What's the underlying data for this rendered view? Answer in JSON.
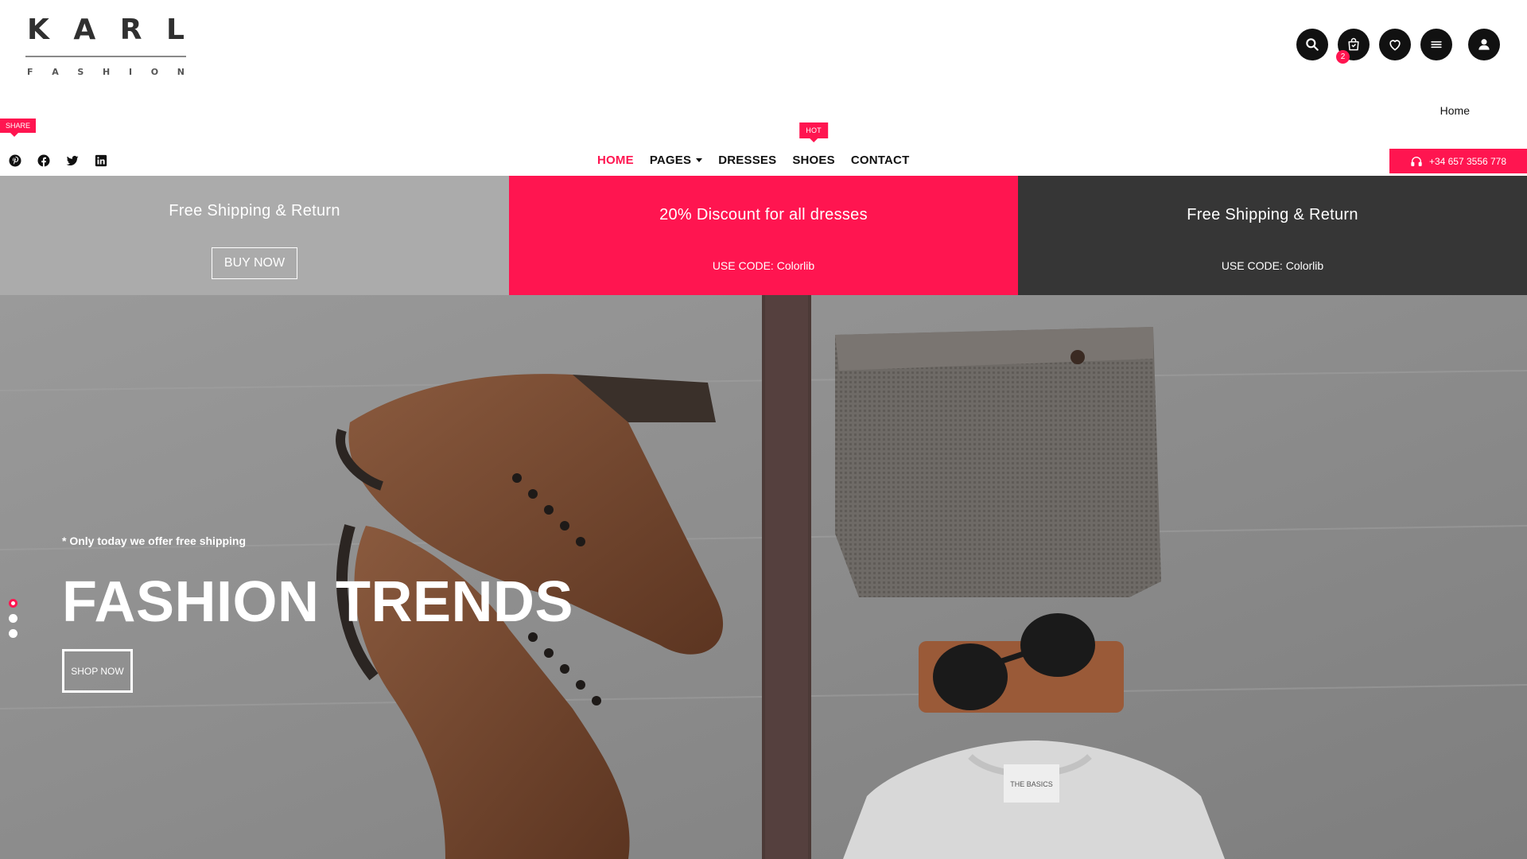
{
  "logo": {
    "main_letters": [
      "K",
      "A",
      "R",
      "L"
    ],
    "sub_letters": [
      "F",
      "A",
      "S",
      "H",
      "I",
      "O",
      "N"
    ]
  },
  "header": {
    "icons": [
      "search-icon",
      "shopping-bag-icon",
      "heart-icon",
      "menu-icon",
      "user-icon"
    ],
    "cart_count": "2",
    "breadcrumb": "Home",
    "share_badge": "SHARE",
    "social": [
      "pinterest-icon",
      "facebook-icon",
      "twitter-icon",
      "linkedin-icon"
    ],
    "phone": "+34 657 3556 778"
  },
  "nav": {
    "items": [
      {
        "label": "HOME",
        "active": true
      },
      {
        "label": "PAGES",
        "dropdown": true
      },
      {
        "label": "DRESSES"
      },
      {
        "label": "SHOES",
        "badge": "HOT"
      },
      {
        "label": "CONTACT"
      }
    ]
  },
  "promos": [
    {
      "title": "Free Shipping & Return",
      "button": "BUY NOW"
    },
    {
      "title": "20% Discount for all dresses",
      "code": "USE CODE: Colorlib"
    },
    {
      "title": "Free Shipping & Return",
      "code": "USE CODE: Colorlib"
    }
  ],
  "hero": {
    "tagline": "* Only today we offer free shipping",
    "title": "FASHION TRENDS",
    "button": "SHOP NOW",
    "slides": 3,
    "active_slide": 1,
    "tshirt_label": "THE BASICS"
  },
  "colors": {
    "accent": "#ff1550",
    "dark": "#363636",
    "grey": "#ababab"
  }
}
